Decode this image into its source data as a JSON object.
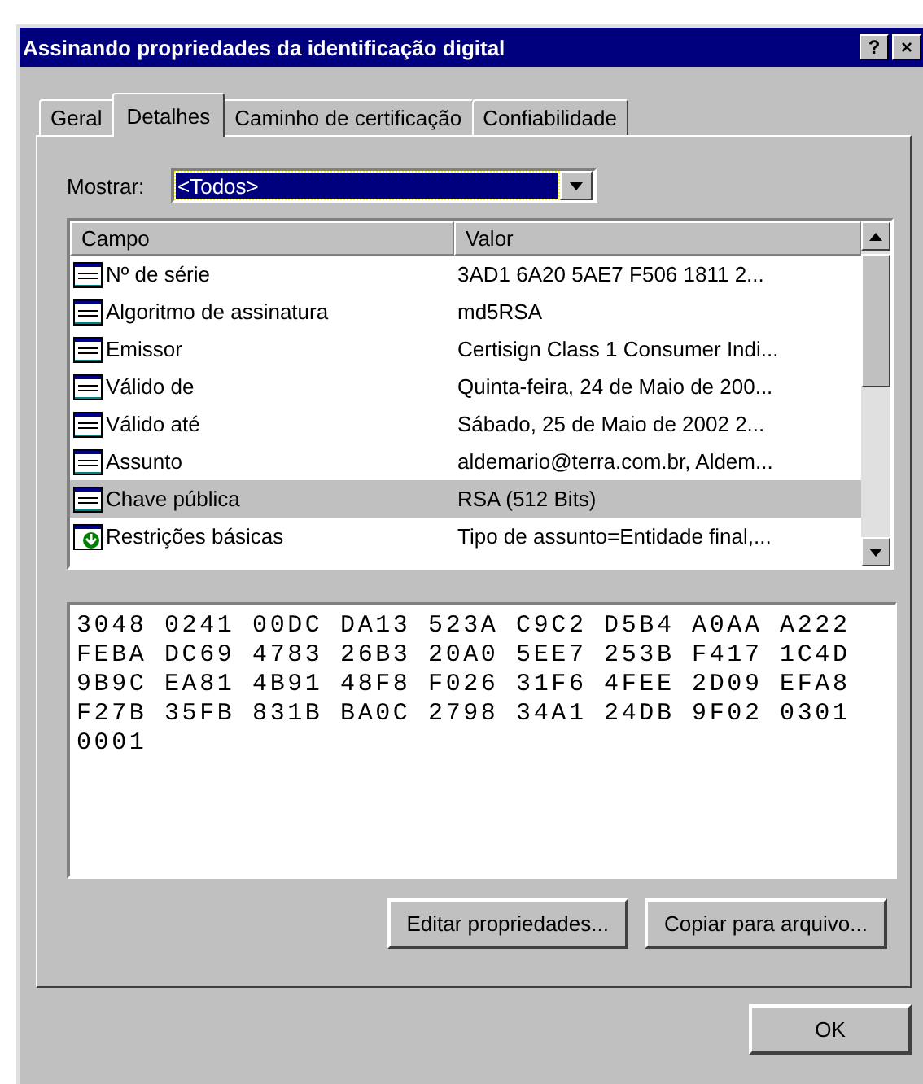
{
  "window": {
    "title": "Assinando propriedades da identificação digital",
    "title_buttons": [
      "?",
      "×"
    ]
  },
  "tabs": [
    {
      "label": "Geral",
      "selected": false
    },
    {
      "label": "Detalhes",
      "selected": true
    },
    {
      "label": "Caminho de certificação",
      "selected": false
    },
    {
      "label": "Confiabilidade",
      "selected": false
    }
  ],
  "show": {
    "label": "Mostrar:",
    "value": "<Todos>"
  },
  "table": {
    "columns": [
      "Campo",
      "Valor"
    ],
    "rows": [
      {
        "kind": "field",
        "field": "Nº de série",
        "value": "3AD1 6A20 5AE7 F506 1811 2...",
        "selected": false
      },
      {
        "kind": "field",
        "field": "Algoritmo de assinatura",
        "value": "md5RSA",
        "selected": false
      },
      {
        "kind": "field",
        "field": "Emissor",
        "value": "Certisign Class 1 Consumer Indi...",
        "selected": false
      },
      {
        "kind": "field",
        "field": "Válido de",
        "value": "Quinta-feira, 24 de Maio de 200...",
        "selected": false
      },
      {
        "kind": "field",
        "field": "Válido até",
        "value": "Sábado, 25 de Maio de 2002 2...",
        "selected": false
      },
      {
        "kind": "field",
        "field": "Assunto",
        "value": "aldemario@terra.com.br, Aldem...",
        "selected": false
      },
      {
        "kind": "field",
        "field": "Chave pública",
        "value": "RSA (512 Bits)",
        "selected": true
      },
      {
        "kind": "extension",
        "field": "Restrições básicas",
        "value": "Tipo de assunto=Entidade final,...",
        "selected": false
      }
    ]
  },
  "detail_lines": [
    "3048 0241 00DC DA13 523A C9C2 D5B4 A0AA A222",
    "FEBA DC69 4783 26B3 20A0 5EE7 253B F417 1C4D",
    "9B9C EA81 4B91 48F8 F026 31F6 4FEE 2D09 EFA8",
    "F27B 35FB 831B BA0C 2798 34A1 24DB 9F02 0301",
    "0001"
  ],
  "buttons": [
    "Editar propriedades...",
    "Copiar para arquivo..."
  ],
  "footer_buttons": [
    "OK"
  ]
}
